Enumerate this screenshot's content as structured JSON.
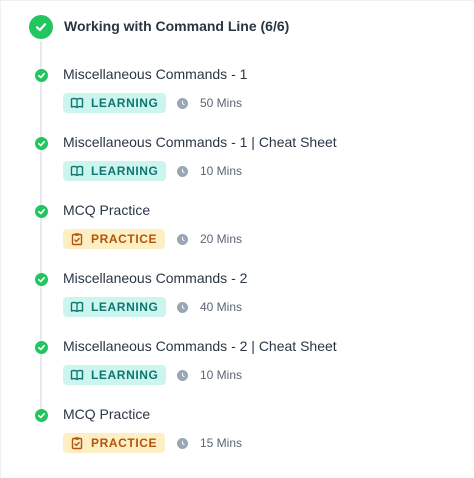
{
  "section": {
    "title": "Working with Command Line (6/6)"
  },
  "items": [
    {
      "title": "Miscellaneous Commands - 1",
      "type": "learning",
      "badge": "LEARNING",
      "duration": "50 Mins"
    },
    {
      "title": "Miscellaneous Commands - 1 | Cheat Sheet",
      "type": "learning",
      "badge": "LEARNING",
      "duration": "10 Mins"
    },
    {
      "title": "MCQ Practice",
      "type": "practice",
      "badge": "PRACTICE",
      "duration": "20 Mins"
    },
    {
      "title": "Miscellaneous Commands - 2",
      "type": "learning",
      "badge": "LEARNING",
      "duration": "40 Mins"
    },
    {
      "title": "Miscellaneous Commands - 2 | Cheat Sheet",
      "type": "learning",
      "badge": "LEARNING",
      "duration": "10 Mins"
    },
    {
      "title": "MCQ Practice",
      "type": "practice",
      "badge": "PRACTICE",
      "duration": "15 Mins"
    }
  ],
  "colors": {
    "complete": "#22c55e",
    "learning_bg": "#cdf5f0",
    "learning_fg": "#0f766e",
    "practice_bg": "#fdefc4",
    "practice_fg": "#b45309"
  },
  "icons": {
    "section_status": "check-circle-icon",
    "item_status": "check-circle-icon",
    "learning": "book-icon",
    "practice": "clipboard-icon",
    "duration": "clock-icon"
  }
}
